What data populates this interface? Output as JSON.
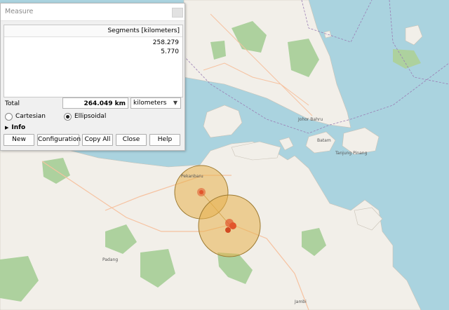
{
  "dialog": {
    "title": "Measure",
    "segments_header": "Segments [kilometers]",
    "segments": [
      "258.279",
      "5.770"
    ],
    "total_label": "Total",
    "total_value": "264.049 km",
    "unit": "kilometers",
    "mode_options": [
      "Cartesian",
      "Ellipsoidal"
    ],
    "selected_mode": "Ellipsoidal",
    "info_label": "Info",
    "buttons": {
      "new": "New",
      "configuration": "Configuration",
      "copy_all": "Copy All",
      "close": "Close",
      "help": "Help"
    }
  },
  "map": {
    "labels": [
      "Johor Bahru",
      "Batam",
      "Tanjung Pinang",
      "Pekanbaru",
      "Padang",
      "Jambi"
    ],
    "colors": {
      "water": "#aad3df",
      "land": "#f2efe9",
      "forest": "#add19e",
      "measure_fill": "#e8b04c",
      "measure_stroke": "#b38a3a",
      "measure_point": "#e2552c"
    }
  }
}
